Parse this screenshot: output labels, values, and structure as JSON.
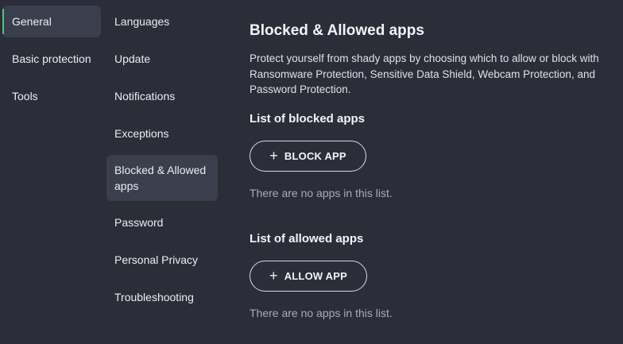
{
  "nav_primary": [
    {
      "label": "General",
      "active": true
    },
    {
      "label": "Basic protection",
      "active": false
    },
    {
      "label": "Tools",
      "active": false
    }
  ],
  "nav_secondary": [
    {
      "label": "Languages",
      "active": false
    },
    {
      "label": "Update",
      "active": false
    },
    {
      "label": "Notifications",
      "active": false
    },
    {
      "label": "Exceptions",
      "active": false
    },
    {
      "label": "Blocked & Allowed apps",
      "active": true
    },
    {
      "label": "Password",
      "active": false
    },
    {
      "label": "Personal Privacy",
      "active": false
    },
    {
      "label": "Troubleshooting",
      "active": false
    }
  ],
  "main": {
    "title": "Blocked & Allowed apps",
    "description": "Protect yourself from shady apps by choosing which to allow or block with Ransomware Protection, Sensitive Data Shield, Webcam Protection, and Password Protection.",
    "blocked": {
      "heading": "List of blocked apps",
      "button_label": "BLOCK APP",
      "empty_text": "There are no apps in this list."
    },
    "allowed": {
      "heading": "List of allowed apps",
      "button_label": "ALLOW APP",
      "empty_text": "There are no apps in this list."
    }
  },
  "colors": {
    "background": "#2b2d38",
    "active_item": "#3b3e4c",
    "accent_indicator": "#4fc77e",
    "muted_text": "#a9abb6"
  },
  "icons": {
    "add": "plus-icon"
  }
}
